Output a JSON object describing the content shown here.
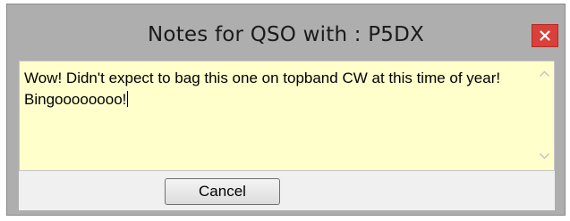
{
  "window": {
    "title": "Notes for QSO with : P5DX"
  },
  "notes": {
    "text": "Wow!  Didn't expect to bag this one on topband CW at this time of year!  Bingoooooooo!"
  },
  "buttons": {
    "cancel_label": "Cancel"
  },
  "colors": {
    "frame": "#aeaeae",
    "close_button": "#d9403a",
    "note_background": "#ffffcc"
  },
  "icons": {
    "close": "close-icon",
    "scroll_up": "chevron-up-icon",
    "scroll_down": "chevron-down-icon"
  }
}
